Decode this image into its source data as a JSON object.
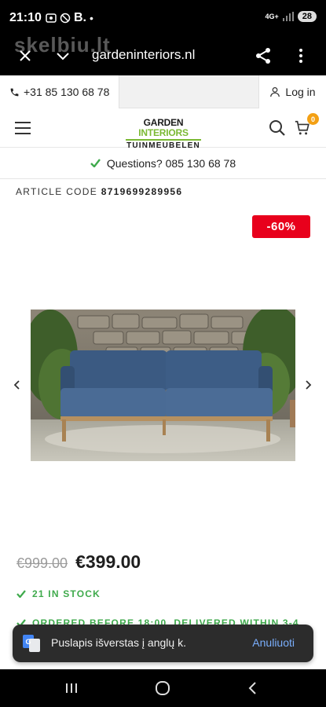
{
  "status_bar": {
    "time": "21:10",
    "notif_text": "B.",
    "network": "4G+",
    "battery": "28"
  },
  "watermark": "skelbiu.lt",
  "browser": {
    "url": "gardeninteriors.nl"
  },
  "contact_bar": {
    "phone": "+31 85 130 68 78",
    "login": "Log in"
  },
  "header": {
    "logo_word1": "GARDEN",
    "logo_word2": "INTERIORS",
    "logo_sub": "TUINMEUBELEN",
    "cart_count": "0"
  },
  "questions": "Questions? 085 130 68 78",
  "product": {
    "article_label": "ARTICLE CODE",
    "article_code": "8719699289956",
    "discount": "-60%",
    "old_price": "€999.00",
    "new_price": "€399.00",
    "stock": "21 IN STOCK",
    "delivery": "ORDERED BEFORE 18:00, DELIVERED WITHIN 3-4"
  },
  "toast": {
    "message": "Puslapis išverstas į anglų k.",
    "action": "Anuliuoti"
  },
  "colors": {
    "accent_green": "#7bb934",
    "stock_green": "#3faa4c",
    "discount_red": "#e8001c",
    "cart_badge": "#f3a014",
    "toast_action": "#7aaefc"
  }
}
